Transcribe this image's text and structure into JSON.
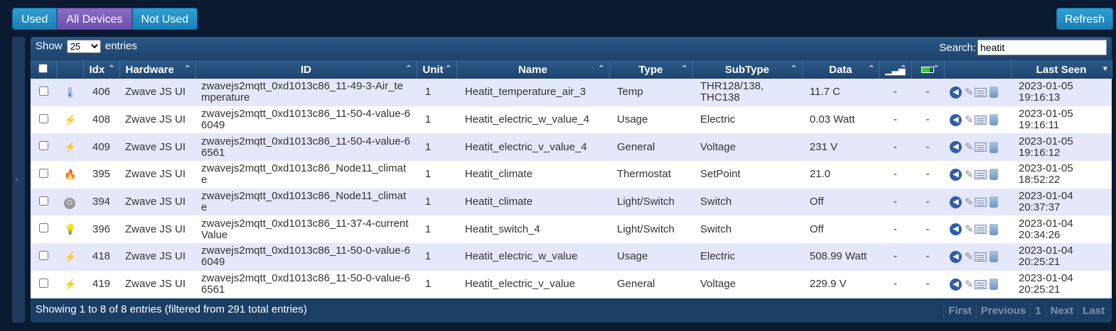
{
  "top_buttons": {
    "used": "Used",
    "all_devices": "All Devices",
    "not_used": "Not Used",
    "refresh": "Refresh"
  },
  "table_controls": {
    "show_label": "Show",
    "page_size": "25",
    "entries_label": "entries",
    "search_label": "Search:",
    "search_value": "heatit"
  },
  "columns": {
    "idx": "Idx",
    "hardware": "Hardware",
    "id": "ID",
    "unit": "Unit",
    "name": "Name",
    "type": "Type",
    "subtype": "SubType",
    "data": "Data",
    "last_seen": "Last Seen"
  },
  "rows": [
    {
      "icon": "thermometer-icon",
      "idx": "406",
      "hardware": "Zwave JS UI",
      "id": "zwavejs2mqtt_0xd1013c86_11-49-3-Air_temperature",
      "unit": "1",
      "name": "Heatit_temperature_air_3",
      "type": "Temp",
      "subtype": "THR128/138, THC138",
      "data": "11.7 C",
      "signal": "-",
      "battery": "-",
      "last_seen": "2023-01-05 19:16:13"
    },
    {
      "icon": "lightning-icon",
      "idx": "408",
      "hardware": "Zwave JS UI",
      "id": "zwavejs2mqtt_0xd1013c86_11-50-4-value-66049",
      "unit": "1",
      "name": "Heatit_electric_w_value_4",
      "type": "Usage",
      "subtype": "Electric",
      "data": "0.03 Watt",
      "signal": "-",
      "battery": "-",
      "last_seen": "2023-01-05 19:16:11"
    },
    {
      "icon": "lightning-icon",
      "idx": "409",
      "hardware": "Zwave JS UI",
      "id": "zwavejs2mqtt_0xd1013c86_11-50-4-value-66561",
      "unit": "1",
      "name": "Heatit_electric_v_value_4",
      "type": "General",
      "subtype": "Voltage",
      "data": "231 V",
      "signal": "-",
      "battery": "-",
      "last_seen": "2023-01-05 19:16:12"
    },
    {
      "icon": "flame-icon",
      "idx": "395",
      "hardware": "Zwave JS UI",
      "id": "zwavejs2mqtt_0xd1013c86_Node11_climate",
      "unit": "1",
      "name": "Heatit_climate",
      "type": "Thermostat",
      "subtype": "SetPoint",
      "data": "21.0",
      "signal": "-",
      "battery": "-",
      "last_seen": "2023-01-05 18:52:22"
    },
    {
      "icon": "power-button-icon",
      "idx": "394",
      "hardware": "Zwave JS UI",
      "id": "zwavejs2mqtt_0xd1013c86_Node11_climate",
      "unit": "1",
      "name": "Heatit_climate",
      "type": "Light/Switch",
      "subtype": "Switch",
      "data": "Off",
      "signal": "-",
      "battery": "-",
      "last_seen": "2023-01-04 20:37:37"
    },
    {
      "icon": "lightbulb-icon",
      "idx": "396",
      "hardware": "Zwave JS UI",
      "id": "zwavejs2mqtt_0xd1013c86_11-37-4-currentValue",
      "unit": "1",
      "name": "Heatit_switch_4",
      "type": "Light/Switch",
      "subtype": "Switch",
      "data": "Off",
      "signal": "-",
      "battery": "-",
      "last_seen": "2023-01-04 20:34:26"
    },
    {
      "icon": "lightning-icon",
      "idx": "418",
      "hardware": "Zwave JS UI",
      "id": "zwavejs2mqtt_0xd1013c86_11-50-0-value-66049",
      "unit": "1",
      "name": "Heatit_electric_w_value",
      "type": "Usage",
      "subtype": "Electric",
      "data": "508.99 Watt",
      "signal": "-",
      "battery": "-",
      "last_seen": "2023-01-04 20:25:21"
    },
    {
      "icon": "lightning-icon",
      "idx": "419",
      "hardware": "Zwave JS UI",
      "id": "zwavejs2mqtt_0xd1013c86_11-50-0-value-66561",
      "unit": "1",
      "name": "Heatit_electric_v_value",
      "type": "General",
      "subtype": "Voltage",
      "data": "229.9 V",
      "signal": "-",
      "battery": "-",
      "last_seen": "2023-01-04 20:25:21"
    }
  ],
  "footer": {
    "info": "Showing 1 to 8 of 8 entries (filtered from 291 total entries)"
  },
  "pager": {
    "first": "First",
    "previous": "Previous",
    "page": "1",
    "next": "Next",
    "last": "Last"
  },
  "colors": {
    "background": "#0a1a30",
    "button_blue": "#1a7fb8",
    "button_active_purple": "#6c4fae",
    "row_alt": "#e4e8fa"
  }
}
